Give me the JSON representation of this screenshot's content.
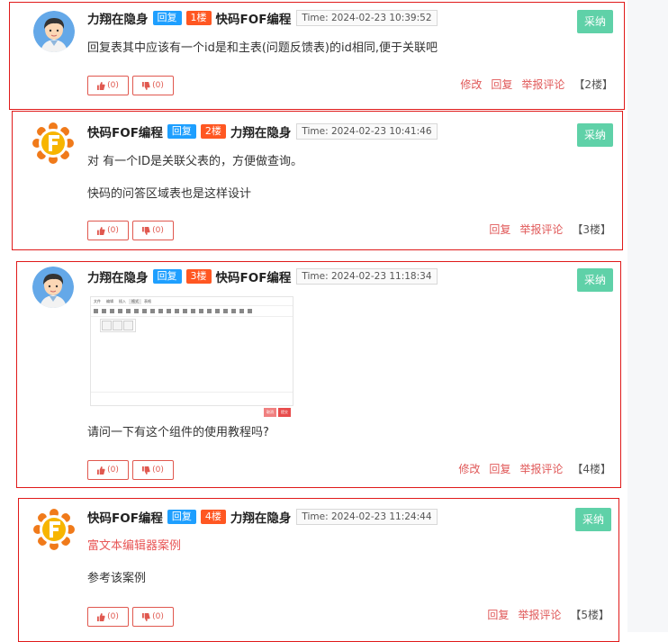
{
  "labels": {
    "reply_tag": "回复",
    "time_prefix": "Time: ",
    "accept": "采纳",
    "edit": "修改",
    "reply": "回复",
    "report": "举报评论"
  },
  "colors": {
    "reply_tag": "#1e9fff",
    "floor_tag": "#ff5722",
    "accept_button": "#5fd1a8",
    "action_link": "#e05858",
    "highlight_border": "#e01a1a"
  },
  "comments": [
    {
      "avatar": "user-avatar",
      "author": "力翔在隐身",
      "floor_tag": "1楼",
      "replied_to": "快码FOF编程",
      "time": "Time: 2024-02-23 10:39:52",
      "lines": [
        "回复表其中应该有一个id是和主表(问题反馈表)的id相同,便于关联吧"
      ],
      "likes": "(0)",
      "dislikes": "(0)",
      "has_edit": true,
      "floor_label": "【2楼】"
    },
    {
      "avatar": "fof-logo",
      "author": "快码FOF编程",
      "floor_tag": "2楼",
      "replied_to": "力翔在隐身",
      "time": "Time: 2024-02-23 10:41:46",
      "lines": [
        "对 有一个ID是关联父表的，方便做查询。",
        "快码的问答区域表也是这样设计"
      ],
      "likes": "(0)",
      "dislikes": "(0)",
      "has_edit": false,
      "floor_label": "【3楼】"
    },
    {
      "avatar": "user-avatar",
      "author": "力翔在隐身",
      "floor_tag": "3楼",
      "replied_to": "快码FOF编程",
      "time": "Time: 2024-02-23 11:18:34",
      "lines": [
        "请问一下有这个组件的使用教程吗?"
      ],
      "likes": "(0)",
      "dislikes": "(0)",
      "has_edit": true,
      "floor_label": "【4楼】",
      "editor_image": {
        "menu": [
          "文件",
          "编辑",
          "插入",
          "格式",
          "表格"
        ],
        "buttons": [
          "取消",
          "提交"
        ]
      }
    },
    {
      "avatar": "fof-logo",
      "author": "快码FOF编程",
      "floor_tag": "4楼",
      "replied_to": "力翔在隐身",
      "time": "Time: 2024-02-23 11:24:44",
      "link": "富文本编辑器案例",
      "lines": [
        "参考该案例"
      ],
      "likes": "(0)",
      "dislikes": "(0)",
      "has_edit": false,
      "floor_label": "【5楼】"
    }
  ]
}
